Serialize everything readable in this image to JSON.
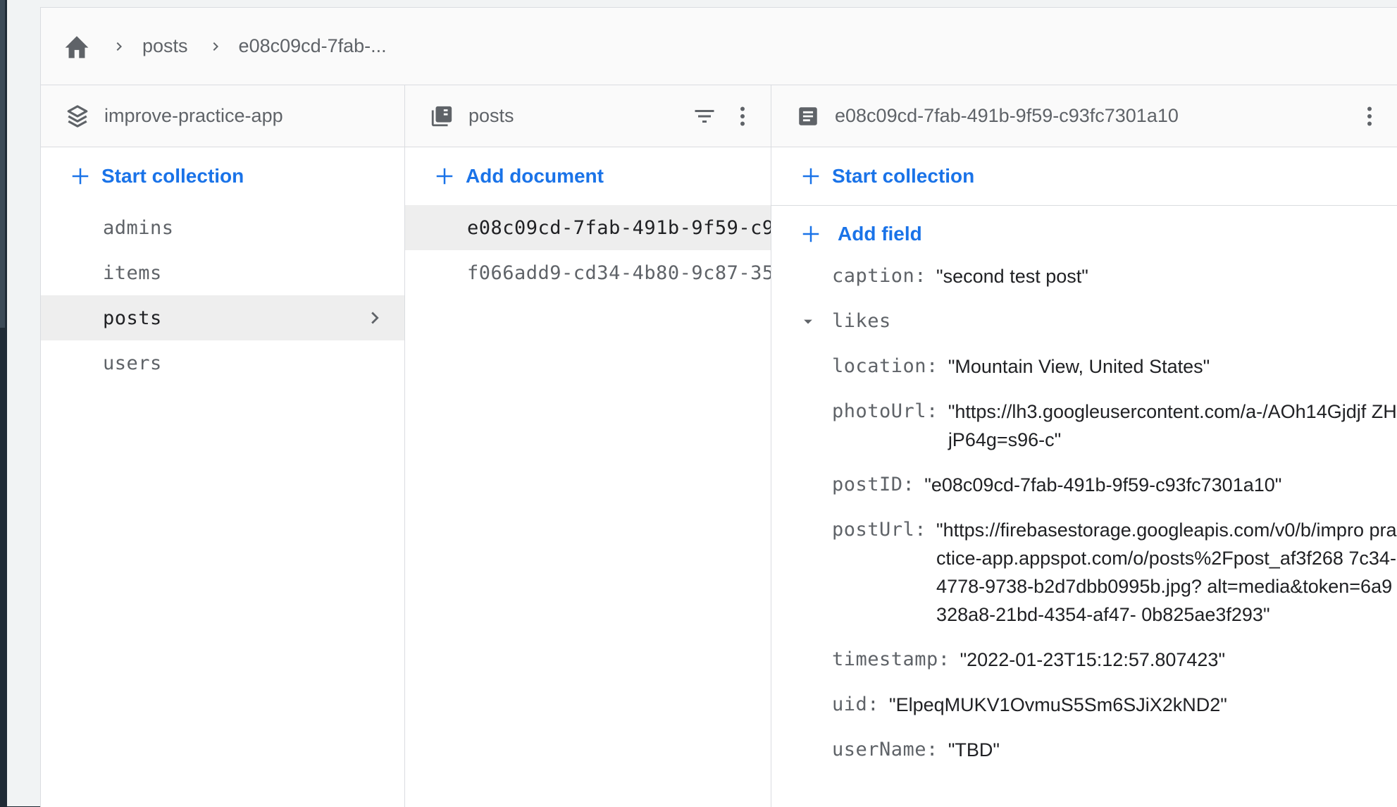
{
  "breadcrumb": {
    "items": [
      "posts",
      "e08c09cd-7fab-..."
    ]
  },
  "columns": {
    "root": {
      "title": "improve-practice-app",
      "action_label": "Start collection",
      "collections": [
        "admins",
        "items",
        "posts",
        "users"
      ],
      "selected": "posts"
    },
    "collection": {
      "title": "posts",
      "action_label": "Add document",
      "documents": [
        "e08c09cd-7fab-491b-9f59-c9",
        "f066add9-cd34-4b80-9c87-35"
      ]
    },
    "document": {
      "title": "e08c09cd-7fab-491b-9f59-c93fc7301a10",
      "start_collection_label": "Start collection",
      "add_field_label": "Add field",
      "fields": [
        {
          "key": "caption:",
          "value": "\"second test post\""
        },
        {
          "key": "likes",
          "value": ""
        },
        {
          "key": "location:",
          "value": "\"Mountain View, United States\""
        },
        {
          "key": "photoUrl:",
          "value": "\"https://lh3.googleusercontent.com/a-/AOh14Gjdjf ZHjP64g=s96-c\""
        },
        {
          "key": "postID:",
          "value": "\"e08c09cd-7fab-491b-9f59-c93fc7301a10\""
        },
        {
          "key": "postUrl:",
          "value": "\"https://firebasestorage.googleapis.com/v0/b/impro practice-app.appspot.com/o/posts%2Fpost_af3f268 7c34-4778-9738-b2d7dbb0995b.jpg? alt=media&token=6a9328a8-21bd-4354-af47- 0b825ae3f293\""
        },
        {
          "key": "timestamp:",
          "value": "\"2022-01-23T15:12:57.807423\""
        },
        {
          "key": "uid:",
          "value": "\"ElpeqMUKV1OvmuS5Sm6SJiX2kND2\""
        },
        {
          "key": "userName:",
          "value": "\"TBD\""
        }
      ]
    }
  },
  "icons": {
    "home": "home-icon",
    "chevron": "chevron-right-icon",
    "project": "firestore-stack-icon",
    "collection": "collection-icon",
    "document": "document-icon",
    "filter": "filter-icon",
    "more": "more-vert-icon",
    "add": "add-icon",
    "expand": "arrow-drop-down-icon"
  },
  "colors": {
    "accent": "#1a73e8",
    "icon": "#5f6368",
    "selected_bg": "#eeeeee"
  }
}
